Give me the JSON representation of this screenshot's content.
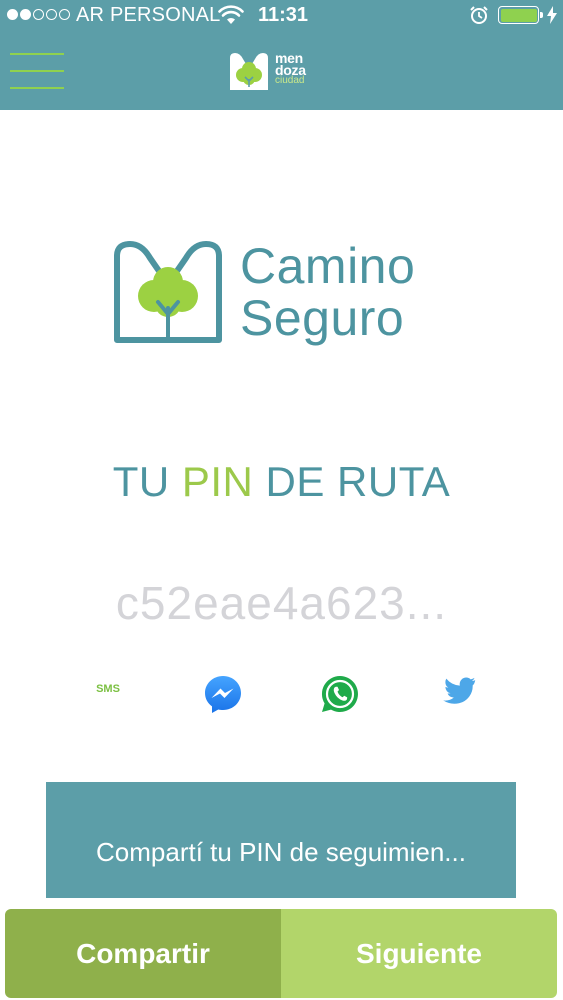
{
  "status_bar": {
    "signal_dots_filled": 2,
    "signal_dots_total": 5,
    "carrier": "AR PERSONAL",
    "time": "11:31",
    "battery_level": 1.0,
    "icons": [
      "wifi-icon",
      "alarm-icon",
      "battery-icon",
      "charging-bolt-icon"
    ]
  },
  "header": {
    "menu_icon": "hamburger-menu-icon",
    "city_logo": {
      "line1": "men",
      "line2": "doza",
      "line3": "ciudad"
    }
  },
  "app_logo": {
    "line1": "Camino",
    "line2": "Seguro"
  },
  "pin_section": {
    "title_part1": "TU ",
    "title_highlight": "PIN",
    "title_part2": " DE RUTA",
    "pin_value": "c52eae4a623..."
  },
  "share_options": [
    {
      "label": "SMS",
      "icon": "sms-icon"
    },
    {
      "label": "",
      "icon": "messenger-icon"
    },
    {
      "label": "",
      "icon": "whatsapp-icon"
    },
    {
      "label": "",
      "icon": "twitter-icon"
    }
  ],
  "info_box": {
    "text": "Compartí tu PIN de seguimien..."
  },
  "buttons": {
    "share": "Compartir",
    "next": "Siguiente"
  },
  "colors": {
    "header_bg": "#5c9ea8",
    "brand_teal": "#4d94a0",
    "brand_green": "#9cc94b",
    "share_button": "#8fb04b",
    "next_button": "#b2d56a",
    "pin_gray": "#d4d4d8"
  }
}
